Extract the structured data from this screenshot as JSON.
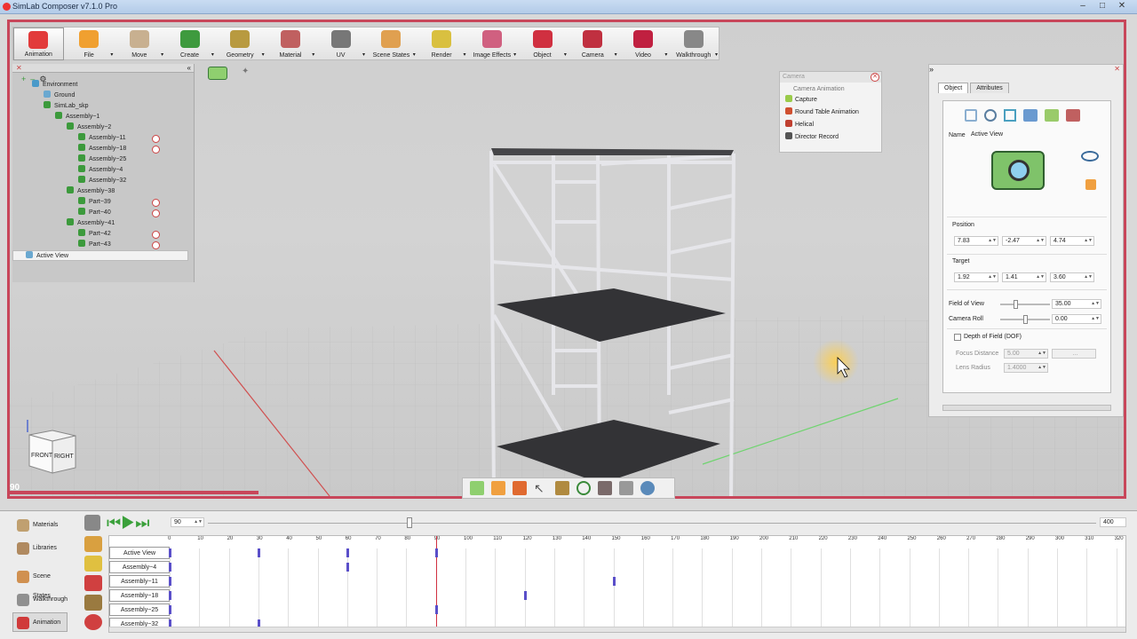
{
  "window": {
    "title": "SimLab Composer v7.1.0 Pro"
  },
  "toolbar": {
    "items": [
      {
        "label": "Animation",
        "icon": "animation-icon",
        "color": "#e23b3b"
      },
      {
        "label": "File",
        "icon": "file-icon",
        "color": "#f0a030"
      },
      {
        "label": "Move",
        "icon": "move-icon",
        "color": "#c8b090"
      },
      {
        "label": "Create",
        "icon": "create-icon",
        "color": "#3e9a3e"
      },
      {
        "label": "Geometry",
        "icon": "geometry-icon",
        "color": "#b89a40"
      },
      {
        "label": "Material",
        "icon": "material-icon",
        "color": "#c06060"
      },
      {
        "label": "UV",
        "icon": "uv-icon",
        "color": "#777777"
      },
      {
        "label": "Scene States",
        "icon": "scene-states-icon",
        "color": "#e0a050"
      },
      {
        "label": "Render",
        "icon": "render-icon",
        "color": "#d9c040"
      },
      {
        "label": "Image Effects",
        "icon": "image-effects-icon",
        "color": "#d06080"
      },
      {
        "label": "Object",
        "icon": "object-icon",
        "color": "#d03040"
      },
      {
        "label": "Camera",
        "icon": "camera-icon",
        "color": "#c03040"
      },
      {
        "label": "Video",
        "icon": "video-icon",
        "color": "#c02040"
      },
      {
        "label": "Walkthrough",
        "icon": "walkthrough-icon",
        "color": "#888888"
      }
    ]
  },
  "tree": {
    "items": [
      {
        "label": "Environment",
        "indent": 0
      },
      {
        "label": "Ground",
        "indent": 1
      },
      {
        "label": "SimLab_skp",
        "indent": 1
      },
      {
        "label": "Assembly~1",
        "indent": 2
      },
      {
        "label": "Assembly~2",
        "indent": 3
      },
      {
        "label": "Assembly~11",
        "indent": 4,
        "badge": true
      },
      {
        "label": "Assembly~18",
        "indent": 4,
        "badge": true
      },
      {
        "label": "Assembly~25",
        "indent": 4
      },
      {
        "label": "Assembly~4",
        "indent": 4
      },
      {
        "label": "Assembly~32",
        "indent": 4
      },
      {
        "label": "Assembly~38",
        "indent": 3
      },
      {
        "label": "Part~39",
        "indent": 4,
        "badge": true
      },
      {
        "label": "Part~40",
        "indent": 4,
        "badge": true
      },
      {
        "label": "Assembly~41",
        "indent": 3
      },
      {
        "label": "Part~42",
        "indent": 4,
        "badge": true
      },
      {
        "label": "Part~43",
        "indent": 4,
        "badge": true
      }
    ],
    "selected": "Active View"
  },
  "camera_popup": {
    "header": "Camera",
    "section": "Camera Animation",
    "items": [
      {
        "label": "Capture",
        "icon": "capture-icon"
      },
      {
        "label": "Round Table Animation",
        "icon": "round-table-icon"
      },
      {
        "label": "Helical",
        "icon": "helical-icon"
      },
      {
        "label": "Director Record",
        "icon": "director-record-icon"
      }
    ]
  },
  "properties": {
    "tabs": [
      "Object",
      "Attributes"
    ],
    "name_label": "Name",
    "name_value": "Active View",
    "position_label": "Position",
    "position": [
      "7.83",
      "-2.47",
      "4.74"
    ],
    "target_label": "Target",
    "target": [
      "1.92",
      "1.41",
      "3.60"
    ],
    "fov_label": "Field of View",
    "fov_value": "35.00",
    "fov_level": 0.29,
    "roll_label": "Camera Roll",
    "roll_value": "0.00",
    "roll_level": 0.5,
    "dof_label": "Depth of Field (DOF)",
    "focus_label": "Focus Distance",
    "focus_value": "5.00",
    "focus_button": "...",
    "lens_label": "Lens Radius",
    "lens_value": "1.4000"
  },
  "viewport": {
    "frame_label": "90",
    "cube_labels": [
      "FRONT",
      "RIGHT"
    ]
  },
  "sidebar": {
    "items": [
      {
        "label": "Materials",
        "icon": "materials-icon",
        "active": false
      },
      {
        "label": "Libraries",
        "icon": "libraries-icon",
        "active": false
      },
      {
        "label": "Scene States",
        "icon": "scene-states-icon",
        "active": false
      },
      {
        "label": "Walkthrough",
        "icon": "walkthrough-icon",
        "active": false
      },
      {
        "label": "Animation",
        "icon": "animation-icon",
        "active": true
      }
    ]
  },
  "playback": {
    "current_frame": "90",
    "end_frame": "400",
    "scrub_level": 0.225
  },
  "timeline": {
    "ticks": [
      "0",
      "10",
      "20",
      "30",
      "40",
      "50",
      "60",
      "70",
      "80",
      "90",
      "100",
      "110",
      "120",
      "130",
      "140",
      "150",
      "160",
      "170",
      "180",
      "190",
      "200",
      "210",
      "220",
      "230",
      "240",
      "250",
      "260",
      "270",
      "280",
      "290",
      "300",
      "310",
      "320"
    ],
    "current_frame": 90,
    "rows": [
      {
        "label": "Active View",
        "keys": [
          0,
          30,
          60,
          90
        ]
      },
      {
        "label": "Assembly~4",
        "keys": [
          0,
          60
        ]
      },
      {
        "label": "Assembly~11",
        "keys": [
          0,
          150
        ]
      },
      {
        "label": "Assembly~18",
        "keys": [
          0,
          120
        ]
      },
      {
        "label": "Assembly~25",
        "keys": [
          0,
          90
        ]
      },
      {
        "label": "Assembly~32",
        "keys": [
          0,
          30
        ]
      }
    ]
  }
}
